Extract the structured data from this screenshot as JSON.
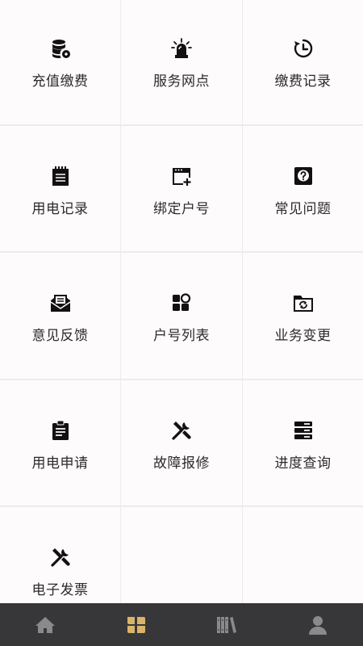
{
  "grid": {
    "items": [
      {
        "label": "充值缴费",
        "icon": "database-coins-icon"
      },
      {
        "label": "服务网点",
        "icon": "alarm-light-icon"
      },
      {
        "label": "缴费记录",
        "icon": "history-clock-icon"
      },
      {
        "label": "用电记录",
        "icon": "notepad-icon"
      },
      {
        "label": "绑定户号",
        "icon": "window-add-icon"
      },
      {
        "label": "常见问题",
        "icon": "question-box-icon"
      },
      {
        "label": "意见反馈",
        "icon": "mail-tray-icon"
      },
      {
        "label": "户号列表",
        "icon": "shapes-icon"
      },
      {
        "label": "业务变更",
        "icon": "folder-sync-icon"
      },
      {
        "label": "用电申请",
        "icon": "clipboard-icon"
      },
      {
        "label": "故障报修",
        "icon": "tools-icon"
      },
      {
        "label": "进度查询",
        "icon": "server-stack-icon"
      },
      {
        "label": "电子发票",
        "icon": "tools-icon"
      }
    ]
  },
  "tabbar": {
    "tabs": [
      {
        "name": "home",
        "icon": "home-icon",
        "active": false
      },
      {
        "name": "services",
        "icon": "grid-icon",
        "active": true
      },
      {
        "name": "library",
        "icon": "books-icon",
        "active": false
      },
      {
        "name": "profile",
        "icon": "user-icon",
        "active": false
      }
    ],
    "colors": {
      "active": "#d9b46a",
      "inactive": "#8a8a8d",
      "background": "#37373a"
    }
  }
}
